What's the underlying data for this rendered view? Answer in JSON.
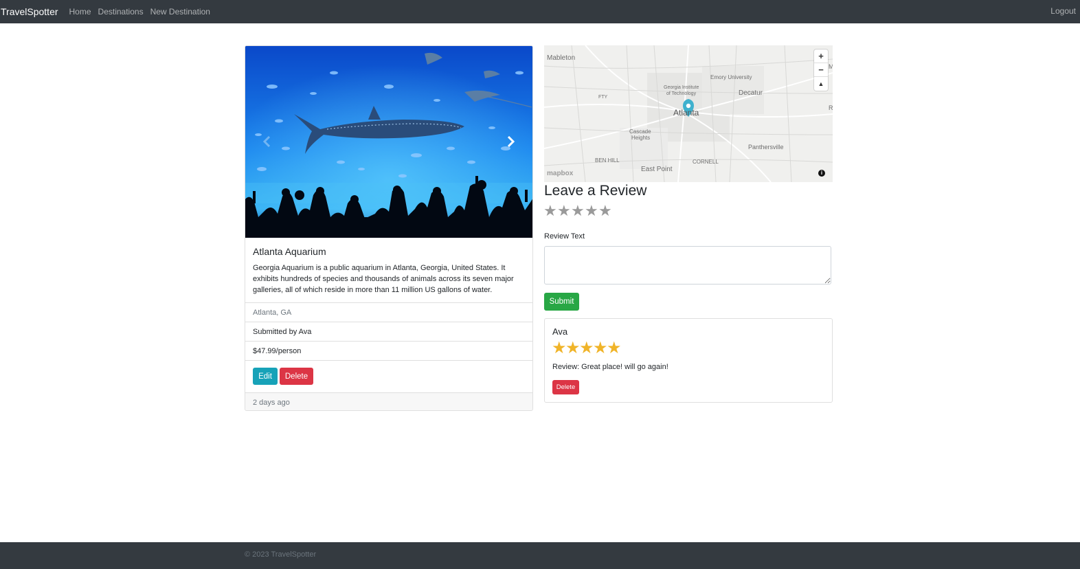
{
  "navbar": {
    "brand": "TravelSpotter",
    "links": [
      "Home",
      "Destinations",
      "New Destination"
    ],
    "logout": "Logout"
  },
  "destination": {
    "title": "Atlanta Aquarium",
    "description": "Georgia Aquarium is a public aquarium in Atlanta, Georgia, United States. It exhibits hundreds of species and thousands of animals across its seven major galleries, all of which reside in more than 11 million US gallons of water.",
    "location": "Atlanta, GA",
    "submitted_by": "Submitted by Ava",
    "price": "$47.99/person",
    "edit_label": "Edit",
    "delete_label": "Delete",
    "posted": "2 days ago",
    "carousel": {
      "prev_icon": "chevron-left-icon",
      "next_icon": "chevron-right-icon"
    }
  },
  "map": {
    "labels": [
      "Mableton",
      "Emory University",
      "Georgia Institute",
      "of Technology",
      "Decatur",
      "FTY",
      "Atlanta",
      "Cascade",
      "Heights",
      "Panthersville",
      "BEN HILL",
      "CORNELL",
      "East Point",
      "M",
      "R"
    ],
    "zoom_in": "+",
    "zoom_out": "−",
    "compass": "▲",
    "logo": "mapbox",
    "info": "i"
  },
  "review_form": {
    "heading": "Leave a Review",
    "rating_max": 5,
    "rating_value": 0,
    "text_label": "Review Text",
    "text_value": "",
    "submit_label": "Submit"
  },
  "reviews": [
    {
      "author": "Ava",
      "rating": 5,
      "text": "Review: Great place! will go again!",
      "delete_label": "Delete"
    }
  ],
  "footer": {
    "text": "© 2023 TravelSpotter"
  },
  "colors": {
    "navbar": "#343a40",
    "info": "#17a2b8",
    "danger": "#dc3545",
    "success": "#28a745",
    "star_filled": "#f0b429",
    "star_empty": "#9a9a9a",
    "map_pin": "#3fb1ce"
  }
}
